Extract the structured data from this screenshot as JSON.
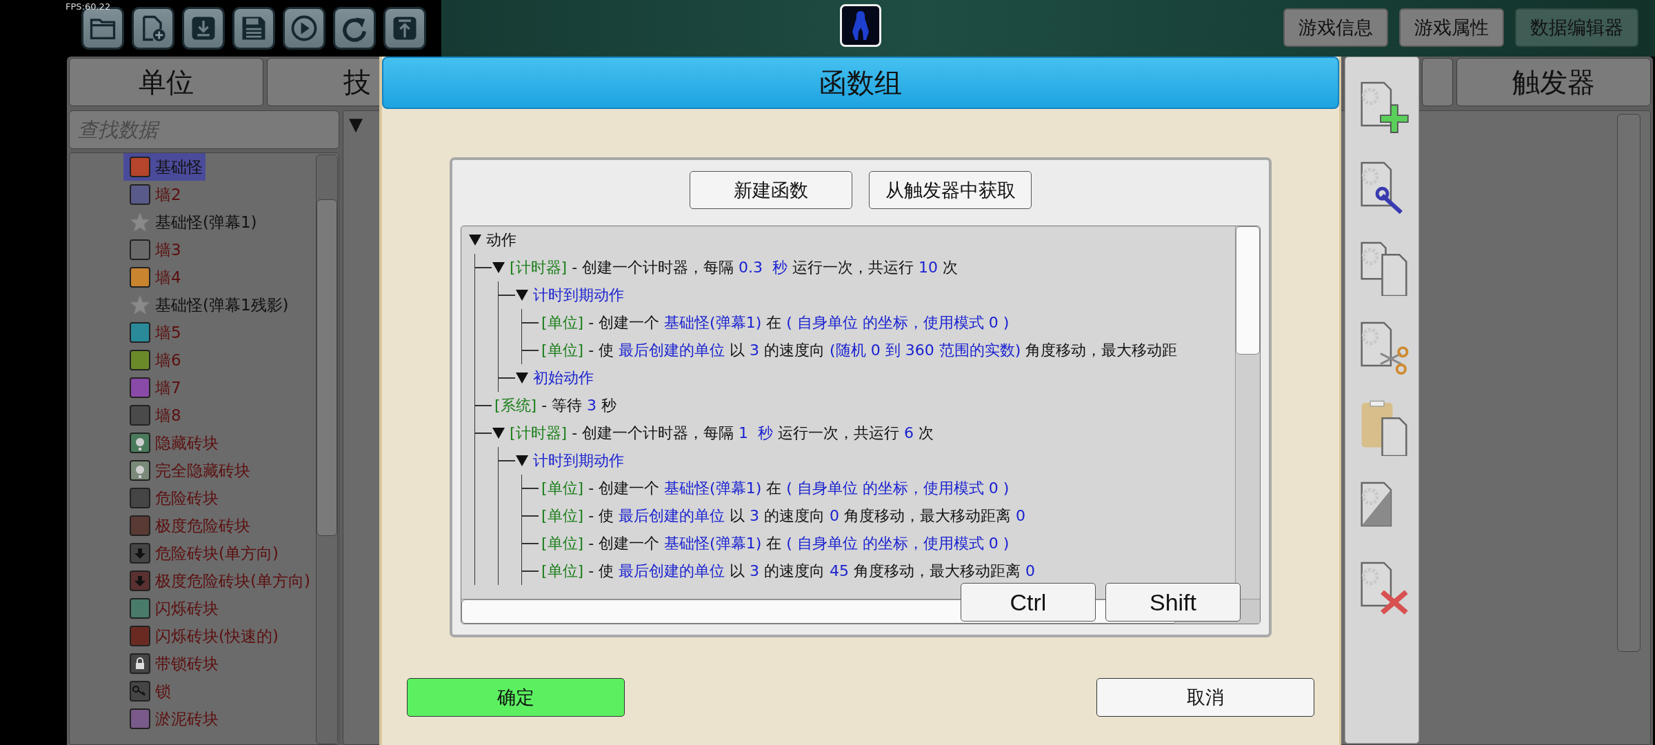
{
  "fps": "FPS:60.22",
  "top_buttons": [
    {
      "label": "游戏信息",
      "selected": false
    },
    {
      "label": "游戏属性",
      "selected": false
    },
    {
      "label": "数据编辑器",
      "selected": true
    }
  ],
  "editor_tabs": [
    "单位",
    "技",
    "触发器"
  ],
  "search": {
    "placeholder": "查找数据"
  },
  "unit_list": [
    {
      "label": "基础怪",
      "kind": "block",
      "color": "#b5452b",
      "selected": true
    },
    {
      "label": "墙2",
      "kind": "block",
      "color": "#5a5a8a",
      "selected": false
    },
    {
      "label": "基础怪(弹幕1)",
      "kind": "star",
      "color": "#8a8a8a",
      "selected": false
    },
    {
      "label": "墙3",
      "kind": "block",
      "color": "#6a6a6a",
      "selected": false
    },
    {
      "label": "墙4",
      "kind": "block",
      "color": "#c8842e",
      "selected": false
    },
    {
      "label": "基础怪(弹幕1残影)",
      "kind": "star",
      "color": "#8a8a8a",
      "selected": false
    },
    {
      "label": "墙5",
      "kind": "block",
      "color": "#2a8a9a",
      "selected": false
    },
    {
      "label": "墙6",
      "kind": "block",
      "color": "#6a8a2a",
      "selected": false
    },
    {
      "label": "墙7",
      "kind": "block",
      "color": "#8a4aa8",
      "selected": false
    },
    {
      "label": "墙8",
      "kind": "block",
      "color": "#4a4a4a",
      "selected": false
    },
    {
      "label": "隐藏砖块",
      "kind": "question",
      "color": "#4a7a5a",
      "selected": false
    },
    {
      "label": "完全隐藏砖块",
      "kind": "question",
      "color": "#7a8a7a",
      "selected": false
    },
    {
      "label": "危险砖块",
      "kind": "block",
      "color": "#454545",
      "selected": false
    },
    {
      "label": "极度危险砖块",
      "kind": "block",
      "color": "#5a3a34",
      "selected": false
    },
    {
      "label": "危险砖块(单方向)",
      "kind": "arrow",
      "color": "#454545",
      "selected": false
    },
    {
      "label": "极度危险砖块(单方向)",
      "kind": "arrow",
      "color": "#5a3030",
      "selected": false
    },
    {
      "label": "闪烁砖块",
      "kind": "block",
      "color": "#4a7a6a",
      "selected": false
    },
    {
      "label": "闪烁砖块(快速的)",
      "kind": "block",
      "color": "#6a2a22",
      "selected": false
    },
    {
      "label": "带锁砖块",
      "kind": "lock",
      "color": "#454545",
      "selected": false
    },
    {
      "label": "锁",
      "kind": "key",
      "color": "#454545",
      "selected": false
    },
    {
      "label": "淤泥砖块",
      "kind": "block",
      "color": "#7a5a8a",
      "selected": false
    }
  ],
  "property_panel": {
    "header": "▼"
  },
  "dialog": {
    "title": "函数组",
    "actions": [
      "新建函数",
      "从触发器中获取"
    ],
    "tree": {
      "kind": "group",
      "expanded": true,
      "segments": [
        {
          "kind": "plain",
          "text": "动作"
        }
      ],
      "children": [
        {
          "kind": "group",
          "expanded": true,
          "segments": [
            {
              "kind": "tag",
              "text": "[计时器]"
            },
            {
              "kind": "plain",
              "text": " - 创建一个计时器，每隔 "
            },
            {
              "kind": "value",
              "text": "0.3  秒"
            },
            {
              "kind": "plain",
              "text": " 运行一次，共运行 "
            },
            {
              "kind": "value",
              "text": "10"
            },
            {
              "kind": "plain",
              "text": " 次"
            }
          ],
          "children": [
            {
              "kind": "group",
              "expanded": true,
              "segments": [
                {
                  "kind": "value",
                  "text": "计时到期动作"
                }
              ],
              "children": [
                {
                  "kind": "action",
                  "segments": [
                    {
                      "kind": "tag",
                      "text": "[单位]"
                    },
                    {
                      "kind": "plain",
                      "text": " - 创建一个 "
                    },
                    {
                      "kind": "value",
                      "text": "基础怪(弹幕1)"
                    },
                    {
                      "kind": "plain",
                      "text": " 在 "
                    },
                    {
                      "kind": "value",
                      "text": "( 自身单位 的坐标，使用模式 0 )"
                    }
                  ]
                },
                {
                  "kind": "action",
                  "segments": [
                    {
                      "kind": "tag",
                      "text": "[单位]"
                    },
                    {
                      "kind": "plain",
                      "text": " - 使 "
                    },
                    {
                      "kind": "value",
                      "text": "最后创建的单位"
                    },
                    {
                      "kind": "plain",
                      "text": " 以 "
                    },
                    {
                      "kind": "value",
                      "text": "3"
                    },
                    {
                      "kind": "plain",
                      "text": " 的速度向 "
                    },
                    {
                      "kind": "value",
                      "text": "(随机 0 到 360 范围的实数)"
                    },
                    {
                      "kind": "plain",
                      "text": " 角度移动，最大移动距"
                    }
                  ]
                }
              ]
            },
            {
              "kind": "group",
              "expanded": true,
              "segments": [
                {
                  "kind": "value",
                  "text": "初始动作"
                }
              ]
            }
          ]
        },
        {
          "kind": "action",
          "segments": [
            {
              "kind": "tag",
              "text": "[系统]"
            },
            {
              "kind": "plain",
              "text": " - 等待 "
            },
            {
              "kind": "value",
              "text": "3"
            },
            {
              "kind": "plain",
              "text": " 秒"
            }
          ]
        },
        {
          "kind": "group",
          "expanded": true,
          "segments": [
            {
              "kind": "tag",
              "text": "[计时器]"
            },
            {
              "kind": "plain",
              "text": " - 创建一个计时器，每隔 "
            },
            {
              "kind": "value",
              "text": "1  秒"
            },
            {
              "kind": "plain",
              "text": " 运行一次，共运行 "
            },
            {
              "kind": "value",
              "text": "6"
            },
            {
              "kind": "plain",
              "text": " 次"
            }
          ],
          "children": [
            {
              "kind": "group",
              "expanded": true,
              "segments": [
                {
                  "kind": "value",
                  "text": "计时到期动作"
                }
              ],
              "children": [
                {
                  "kind": "action",
                  "segments": [
                    {
                      "kind": "tag",
                      "text": "[单位]"
                    },
                    {
                      "kind": "plain",
                      "text": " - 创建一个 "
                    },
                    {
                      "kind": "value",
                      "text": "基础怪(弹幕1)"
                    },
                    {
                      "kind": "plain",
                      "text": " 在 "
                    },
                    {
                      "kind": "value",
                      "text": "( 自身单位 的坐标，使用模式 0 )"
                    }
                  ]
                },
                {
                  "kind": "action",
                  "segments": [
                    {
                      "kind": "tag",
                      "text": "[单位]"
                    },
                    {
                      "kind": "plain",
                      "text": " - 使 "
                    },
                    {
                      "kind": "value",
                      "text": "最后创建的单位"
                    },
                    {
                      "kind": "plain",
                      "text": " 以 "
                    },
                    {
                      "kind": "value",
                      "text": "3"
                    },
                    {
                      "kind": "plain",
                      "text": " 的速度向 "
                    },
                    {
                      "kind": "value",
                      "text": "0"
                    },
                    {
                      "kind": "plain",
                      "text": " 角度移动，最大移动距离 "
                    },
                    {
                      "kind": "value",
                      "text": "0"
                    }
                  ]
                },
                {
                  "kind": "action",
                  "segments": [
                    {
                      "kind": "tag",
                      "text": "[单位]"
                    },
                    {
                      "kind": "plain",
                      "text": " - 创建一个 "
                    },
                    {
                      "kind": "value",
                      "text": "基础怪(弹幕1)"
                    },
                    {
                      "kind": "plain",
                      "text": " 在 "
                    },
                    {
                      "kind": "value",
                      "text": "( 自身单位 的坐标，使用模式 0 )"
                    }
                  ]
                },
                {
                  "kind": "action",
                  "segments": [
                    {
                      "kind": "tag",
                      "text": "[单位]"
                    },
                    {
                      "kind": "plain",
                      "text": " - 使 "
                    },
                    {
                      "kind": "value",
                      "text": "最后创建的单位"
                    },
                    {
                      "kind": "plain",
                      "text": " 以 "
                    },
                    {
                      "kind": "value",
                      "text": "3"
                    },
                    {
                      "kind": "plain",
                      "text": " 的速度向 "
                    },
                    {
                      "kind": "value",
                      "text": "45"
                    },
                    {
                      "kind": "plain",
                      "text": " 角度移动，最大移动距离 "
                    },
                    {
                      "kind": "value",
                      "text": "0"
                    }
                  ]
                }
              ]
            }
          ]
        }
      ]
    },
    "modifier_keys": [
      "Ctrl",
      "Shift"
    ],
    "confirm": "确定",
    "cancel": "取消"
  }
}
